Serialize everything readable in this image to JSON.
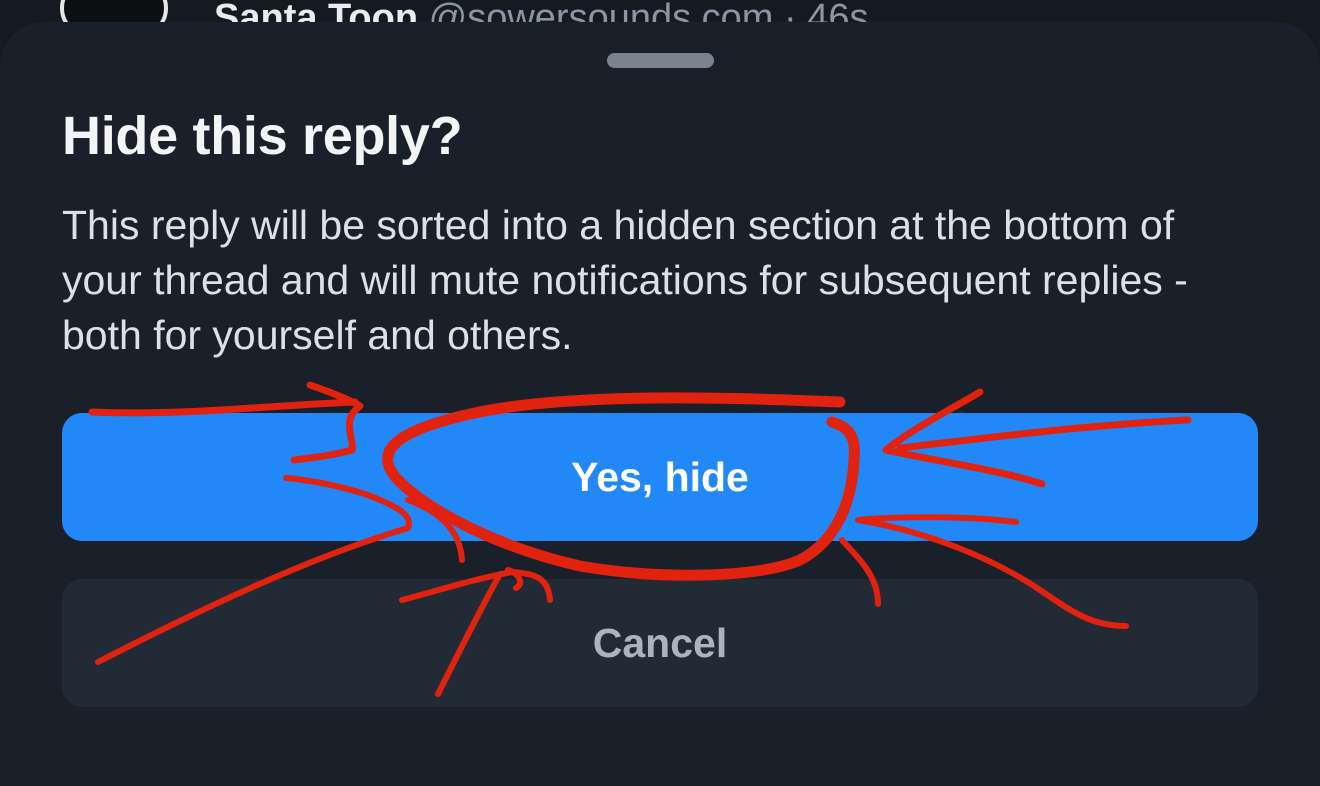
{
  "background_post": {
    "author_name": "Santa Toon",
    "author_handle_time": "@sowersounds.com · 46s"
  },
  "dialog": {
    "title": "Hide this reply?",
    "message": "This reply will be sorted into a hidden section at the bottom of your thread and will mute notifications for subsequent replies - both for yourself and others.",
    "confirm_label": "Yes, hide",
    "cancel_label": "Cancel"
  },
  "colors": {
    "sheet_background": "#19202a",
    "primary_button": "#2288f8",
    "secondary_button": "#222a35",
    "annotation_red": "#e0220f"
  }
}
